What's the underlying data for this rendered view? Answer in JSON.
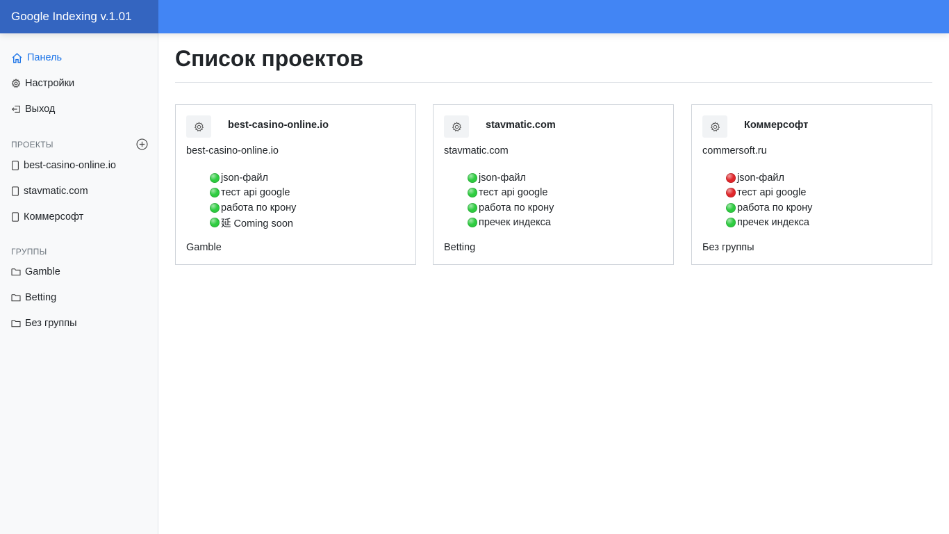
{
  "app": {
    "title": "Google Indexing v.1.01"
  },
  "colors": {
    "topbar": "#4285f4",
    "brand": "#3465c0",
    "active_link": "#1a73e8",
    "status_ok": "#2ecc40",
    "status_error": "#e0262a"
  },
  "sidebar": {
    "nav": [
      {
        "label": "Панель",
        "icon": "home-icon",
        "active": true
      },
      {
        "label": "Настройки",
        "icon": "gear-icon",
        "active": false
      },
      {
        "label": "Выход",
        "icon": "logout-icon",
        "active": false
      }
    ],
    "projects_heading": "ПРОЕКТЫ",
    "add_project_icon": "plus-circle-icon",
    "projects": [
      {
        "label": "best-casino-online.io",
        "icon": "file-icon"
      },
      {
        "label": "stavmatic.com",
        "icon": "file-icon"
      },
      {
        "label": "Коммерсофт",
        "icon": "file-icon"
      }
    ],
    "groups_heading": "ГРУППЫ",
    "groups": [
      {
        "label": "Gamble",
        "icon": "folder-icon"
      },
      {
        "label": "Betting",
        "icon": "folder-icon"
      },
      {
        "label": "Без группы",
        "icon": "folder-icon"
      }
    ]
  },
  "main": {
    "title": "Список проектов",
    "projects": [
      {
        "name": "best-casino-online.io",
        "domain": "best-casino-online.io",
        "group": "Gamble",
        "checks": [
          {
            "label": "json-файл",
            "status": "ok"
          },
          {
            "label": "тест api google",
            "status": "ok"
          },
          {
            "label": "работа по крону",
            "status": "ok"
          },
          {
            "label": "延 Coming soon",
            "status": "ok"
          }
        ]
      },
      {
        "name": "stavmatic.com",
        "domain": "stavmatic.com",
        "group": "Betting",
        "checks": [
          {
            "label": "json-файл",
            "status": "ok"
          },
          {
            "label": "тест api google",
            "status": "ok"
          },
          {
            "label": "работа по крону",
            "status": "ok"
          },
          {
            "label": "пречек индекса",
            "status": "ok"
          }
        ]
      },
      {
        "name": "Коммерсофт",
        "domain": "commersoft.ru",
        "group": "Без группы",
        "checks": [
          {
            "label": "json-файл",
            "status": "error"
          },
          {
            "label": "тест api google",
            "status": "error"
          },
          {
            "label": "работа по крону",
            "status": "ok"
          },
          {
            "label": "пречек индекса",
            "status": "ok"
          }
        ]
      }
    ]
  }
}
